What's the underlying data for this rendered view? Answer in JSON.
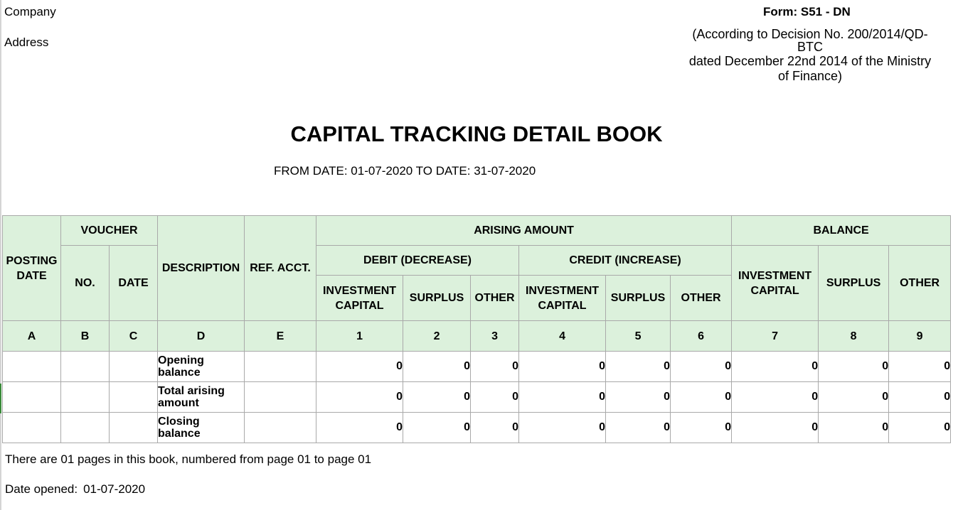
{
  "header": {
    "company_label": "Company",
    "address_label": "Address",
    "form_code": "Form: S51 - DN",
    "decision_line1": "(According to Decision No. 200/2014/QD-",
    "decision_line2": "BTC",
    "decision_line3": "dated December 22nd 2014 of the Ministry",
    "decision_line4": "of Finance)"
  },
  "title": "CAPITAL TRACKING DETAIL BOOK",
  "date_range": "FROM DATE: 01-07-2020 TO DATE: 31-07-2020",
  "table": {
    "headers": {
      "posting_date": "POSTING DATE",
      "voucher": "VOUCHER",
      "voucher_no": "NO.",
      "voucher_date": "DATE",
      "description": "DESCRIPTION",
      "ref_acct": "REF. ACCT.",
      "arising_amount": "ARISING AMOUNT",
      "debit": "DEBIT (DECREASE)",
      "credit": "CREDIT (INCREASE)",
      "balance": "BALANCE",
      "investment_capital": "INVESTMENT CAPITAL",
      "surplus": "SURPLUS",
      "other": "OTHER"
    },
    "index_row": [
      "A",
      "B",
      "C",
      "D",
      "E",
      "1",
      "2",
      "3",
      "4",
      "5",
      "6",
      "7",
      "8",
      "9"
    ],
    "rows": [
      {
        "description": "Opening balance",
        "values": [
          "0",
          "0",
          "0",
          "0",
          "0",
          "0",
          "0",
          "0",
          "0"
        ]
      },
      {
        "description": "Total arising amount",
        "values": [
          "0",
          "0",
          "0",
          "0",
          "0",
          "0",
          "0",
          "0",
          "0"
        ]
      },
      {
        "description": "Closing balance",
        "values": [
          "0",
          "0",
          "0",
          "0",
          "0",
          "0",
          "0",
          "0",
          "0"
        ]
      }
    ]
  },
  "footer": {
    "pages_note": "There are 01 pages in this book, numbered from page 01 to page 01",
    "date_opened_label": "Date opened:",
    "date_opened_value": "01-07-2020"
  },
  "colors": {
    "header_fill": "#dcf1dc",
    "grid_line": "#a9a9a9"
  }
}
